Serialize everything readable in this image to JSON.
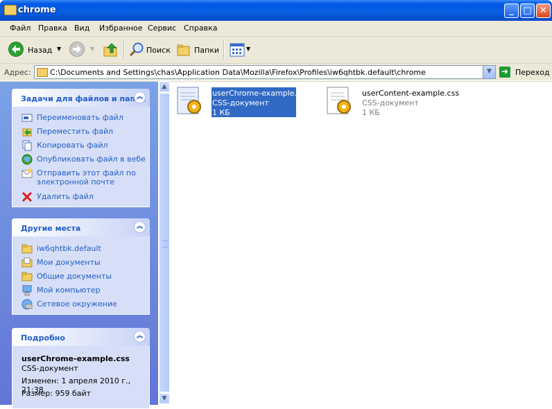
{
  "window": {
    "title": "chrome",
    "min_label": "_",
    "max_label": "□",
    "close_label": "✕"
  },
  "menu": [
    "Файл",
    "Правка",
    "Вид",
    "Избранное",
    "Сервис",
    "Справка"
  ],
  "toolbar": {
    "back": "Назад",
    "search": "Поиск",
    "folders": "Папки"
  },
  "address": {
    "label": "Адрес:",
    "path": "C:\\Documents and Settings\\chas\\Application Data\\Mozilla\\Firefox\\Profiles\\iw6qhtbk.default\\chrome",
    "go": "Переход"
  },
  "panels": {
    "tasks": {
      "title": "Задачи для файлов и папок",
      "items": [
        "Переименовать файл",
        "Переместить файл",
        "Копировать файл",
        "Опубликовать файл в вебе",
        "Отправить этот файл по",
        "электронной почте",
        "Удалить файл"
      ]
    },
    "places": {
      "title": "Другие места",
      "items": [
        "iw6qhtbk.default",
        "Мои документы",
        "Общие документы",
        "Мой компьютер",
        "Сетевое окружение"
      ]
    },
    "details": {
      "title": "Подробно",
      "name": "userChrome-example.css",
      "type": "CSS-документ",
      "modified": "Изменен: 1 апреля 2010 г., 21:38",
      "size": "Размер: 959 байт"
    }
  },
  "files": [
    {
      "name": "userChrome-example.css",
      "type": "CSS-документ",
      "size": "1 КБ",
      "selected": true
    },
    {
      "name": "userContent-example.css",
      "type": "CSS-документ",
      "size": "1 КБ",
      "selected": false
    }
  ],
  "colors": {
    "title_blue": "#0058e6",
    "task_link": "#215dc6",
    "selection": "#316ac5",
    "pane_bg": "#6d8cdc"
  }
}
